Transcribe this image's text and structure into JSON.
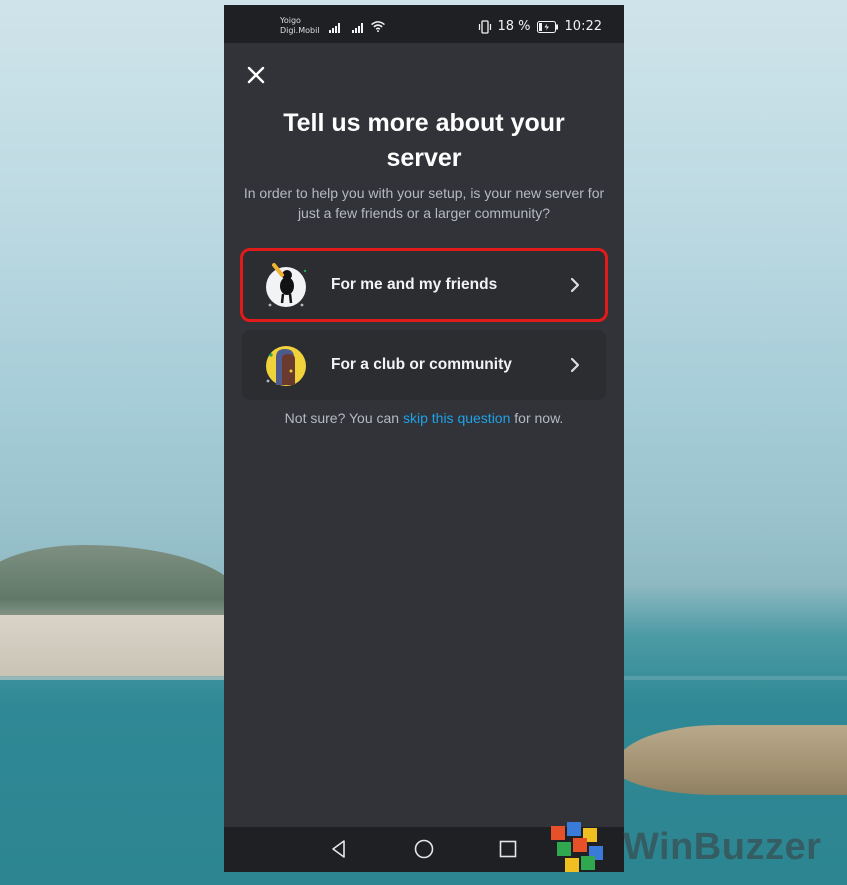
{
  "statusbar": {
    "carrier_line1": "Yoigo",
    "carrier_line2": "Digi.Mobil",
    "battery_percent": "18 %",
    "time": "10:22"
  },
  "dialog": {
    "title": "Tell us more about your server",
    "subtitle": "In order to help you with your setup, is your new server for just a few friends or a larger community?",
    "options": [
      {
        "label": "For me and my friends",
        "highlighted": true
      },
      {
        "label": "For a club or community",
        "highlighted": false
      }
    ],
    "footer_prefix": "Not sure? You can ",
    "footer_link": "skip this question",
    "footer_suffix": " for now."
  },
  "watermark": {
    "text": "WinBuzzer"
  },
  "colors": {
    "background": "#313338",
    "card": "#2b2d31",
    "link": "#1ea2e8",
    "highlight_border": "#e11a1a"
  },
  "icons": {
    "close": "close-icon",
    "chevron": "chevron-right-icon",
    "nav_back": "triangle-back-icon",
    "nav_home": "circle-home-icon",
    "nav_recents": "square-recents-icon"
  }
}
